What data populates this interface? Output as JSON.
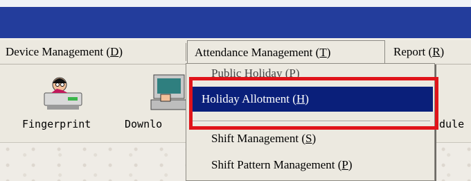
{
  "menubar": {
    "items": [
      {
        "label": "Device Management",
        "key": "D"
      },
      {
        "label": "Attendance Management",
        "key": "T"
      },
      {
        "label": "Report",
        "key": "R"
      }
    ]
  },
  "toolbar": {
    "fingerprint_label": "Fingerprint",
    "download_label": "Downlo",
    "schedule_label": "dule"
  },
  "dropdown": {
    "items": [
      {
        "label": "Public Holiday",
        "key": "P"
      },
      {
        "label": "Holiday Allotment",
        "key": "H"
      },
      {
        "label": "Shift Management",
        "key": "S"
      },
      {
        "label": "Shift Pattern Management",
        "key": "P"
      }
    ]
  },
  "colors": {
    "title_bar": "#233d9c",
    "selection": "#0a1f7a",
    "highlight_box": "#e0141a"
  }
}
